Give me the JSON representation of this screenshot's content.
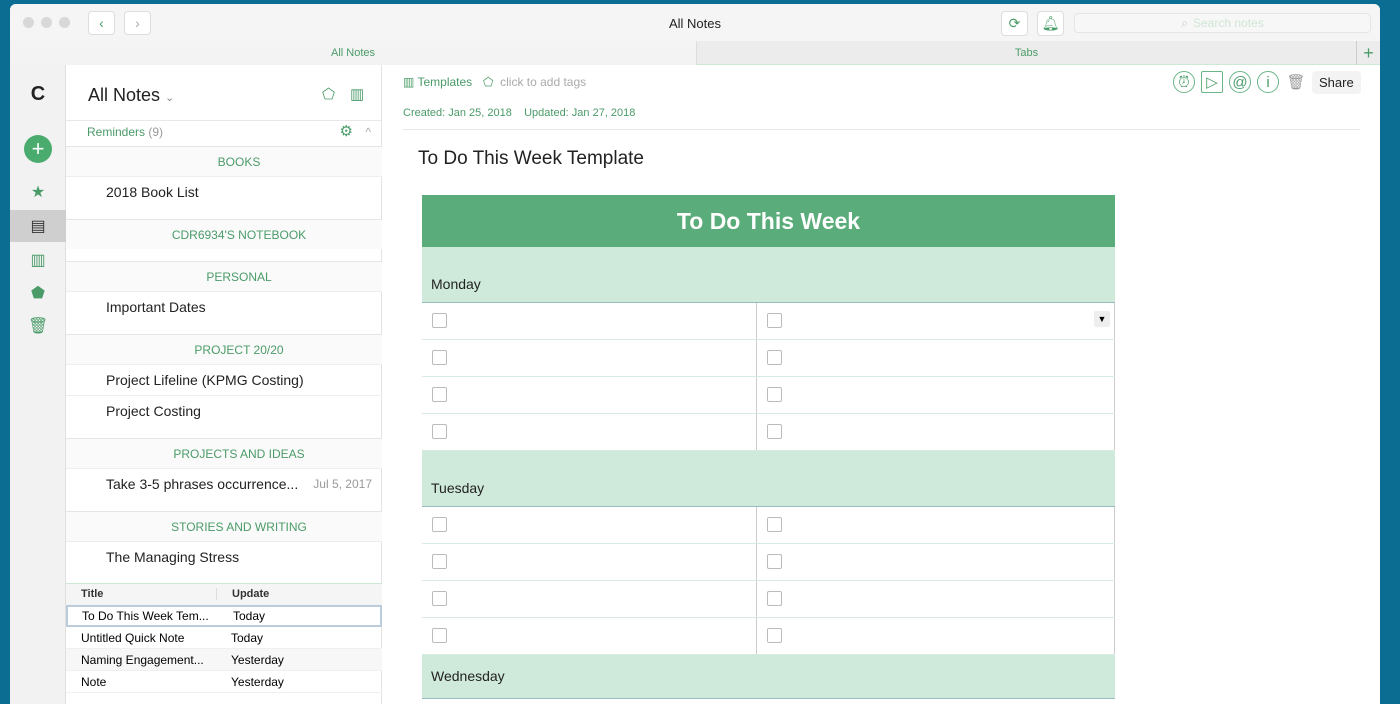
{
  "window": {
    "title": "All Notes",
    "search_placeholder": "Search notes"
  },
  "tabs": [
    {
      "label": "All Notes"
    },
    {
      "label": "Tabs"
    }
  ],
  "notelist": {
    "title": "All Notes",
    "reminders_label": "Reminders",
    "reminders_count": "(9)",
    "groups": [
      {
        "name": "BOOKS",
        "notes": [
          {
            "title": "2018 Book List",
            "date": ""
          }
        ]
      },
      {
        "name": "CDR6934'S NOTEBOOK",
        "notes": []
      },
      {
        "name": "PERSONAL",
        "notes": [
          {
            "title": "Important Dates",
            "date": ""
          }
        ]
      },
      {
        "name": "PROJECT 20/20",
        "notes": [
          {
            "title": "Project Lifeline (KPMG Costing)",
            "date": ""
          },
          {
            "title": "Project Costing",
            "date": ""
          }
        ]
      },
      {
        "name": "PROJECTS AND IDEAS",
        "notes": [
          {
            "title": "Take 3-5 phrases occurrence...",
            "date": "Jul 5, 2017"
          }
        ]
      },
      {
        "name": "STORIES AND WRITING",
        "notes": [
          {
            "title": "The Managing Stress",
            "date": ""
          }
        ]
      }
    ],
    "table": {
      "col_title": "Title",
      "col_update": "Update",
      "rows": [
        {
          "title": "To Do This Week Tem...",
          "update": "Today"
        },
        {
          "title": "Untitled Quick Note",
          "update": "Today"
        },
        {
          "title": "Naming Engagement...",
          "update": "Yesterday"
        },
        {
          "title": "Note",
          "update": "Yesterday"
        }
      ]
    }
  },
  "note": {
    "notebook": "Templates",
    "tags_placeholder": "click to add tags",
    "created": "Created: Jan 25, 2018",
    "updated": "Updated: Jan 27, 2018",
    "title": "To Do This Week Template",
    "share_label": "Share",
    "table_title": "To Do This Week",
    "days": [
      "Monday",
      "Tuesday",
      "Wednesday"
    ]
  }
}
